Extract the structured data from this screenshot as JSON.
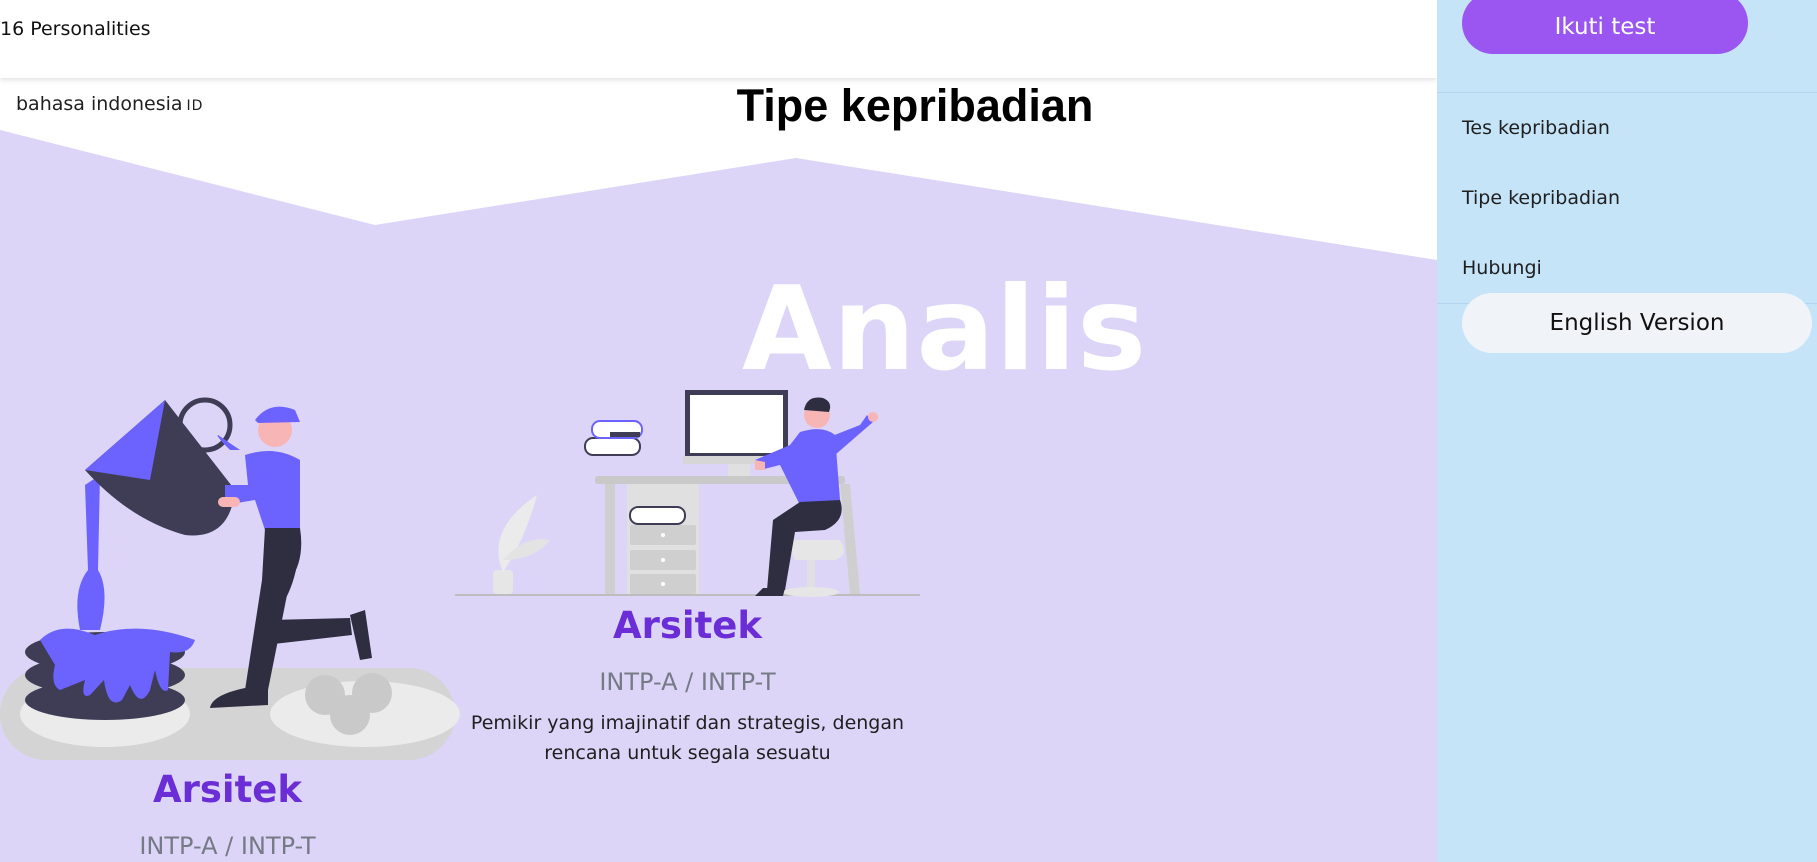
{
  "header": {
    "brand": "16 Personalities",
    "language": "bahasa indonesia",
    "language_code": "ID"
  },
  "page": {
    "title": "Tipe kepribadian",
    "group_heading": "Analis"
  },
  "cards": [
    {
      "name": "Arsitek",
      "codes": "INTP-A / INTP-T",
      "description_line1": "",
      "description_line2": ""
    },
    {
      "name": "Arsitek",
      "codes": "INTP-A / INTP-T",
      "description_line1": "Pemikir yang imajinatif dan strategis, dengan",
      "description_line2": "rencana untuk segala sesuatu"
    }
  ],
  "sidebar": {
    "cta": "Ikuti test",
    "nav": [
      "Tes kepribadian",
      "Tipe kepribadian",
      "Hubungi"
    ],
    "english_button": "English Version"
  },
  "colors": {
    "accent": "#9b55f0",
    "title": "#6b2dd6",
    "band": "#dcd5f8",
    "sidebar": "#c5e4f8",
    "illustration_primary": "#6c63ff"
  }
}
